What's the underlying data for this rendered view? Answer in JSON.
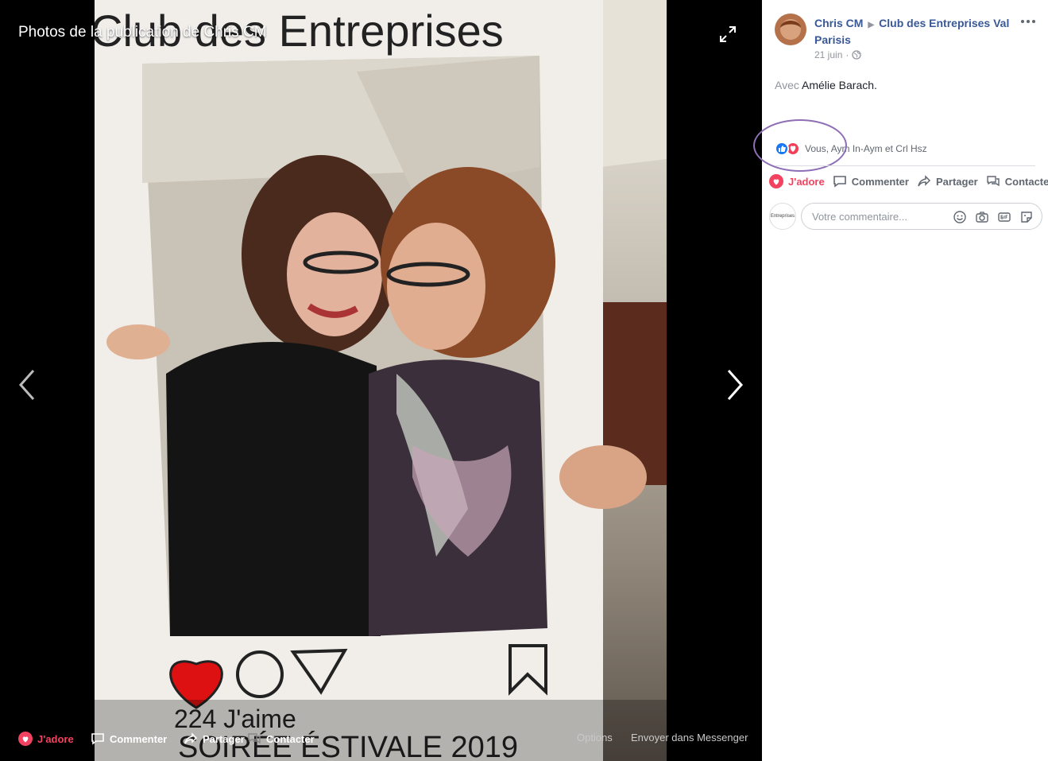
{
  "viewer": {
    "title": "Photos de la publication de Chris CM",
    "photo": {
      "frame_header": "Club des Entreprises",
      "frame_likes": "224 J'aime",
      "frame_footer": "SOIRÉE ÉSTIVALE 2019"
    },
    "bottom_bar": {
      "love": "J'adore",
      "comment": "Commenter",
      "share": "Partager",
      "contact": "Contacter",
      "options": "Options",
      "messenger": "Envoyer dans Messenger"
    }
  },
  "post": {
    "author": "Chris CM",
    "group": "Club des Entreprises Val Parisis",
    "date": "21 juin",
    "tag_prefix": "Avec",
    "tag_name": "Amélie Barach.",
    "reactions_text": "Vous, Aym In-Aym et Crl Hsz",
    "actions": {
      "love": "J'adore",
      "comment": "Commenter",
      "share": "Partager",
      "contact": "Contacter"
    },
    "commenter_avatar_text": "Entreprises",
    "comment_placeholder": "Votre commentaire..."
  },
  "colors": {
    "link": "#385898",
    "love": "#f3425f",
    "like": "#1877f2",
    "highlight": "#8e6fb5"
  },
  "icons": [
    "expand-icon",
    "chevron-left-icon",
    "chevron-right-icon",
    "heart-icon",
    "comment-icon",
    "share-icon",
    "messenger-icon",
    "globe-icon",
    "more-icon",
    "like-reaction-icon",
    "love-reaction-icon",
    "emoji-icon",
    "camera-icon",
    "gif-icon",
    "sticker-icon"
  ]
}
